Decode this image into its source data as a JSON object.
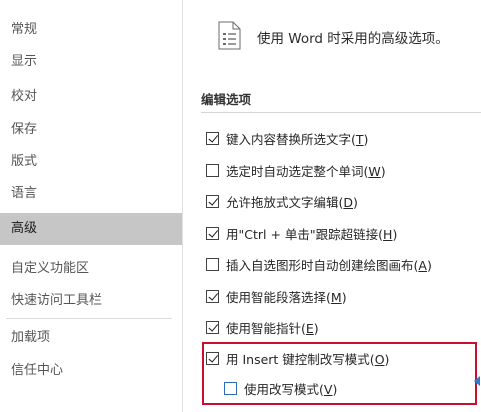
{
  "sidebar": {
    "items": [
      {
        "label": "常规"
      },
      {
        "label": "显示"
      },
      {
        "label": "校对"
      },
      {
        "label": "保存"
      },
      {
        "label": "版式"
      },
      {
        "label": "语言"
      },
      {
        "label": "高级",
        "active": true
      },
      {
        "label": "自定义功能区"
      },
      {
        "label": "快速访问工具栏"
      },
      {
        "label": "加载项"
      },
      {
        "label": "信任中心"
      }
    ]
  },
  "main": {
    "header_text": "使用 Word 时采用的高级选项。",
    "header_icon": "document-settings-icon",
    "section_title": "编辑选项",
    "options": [
      {
        "text": "键入内容替换所选文字(",
        "key": "T",
        "tail": ")",
        "checked": true
      },
      {
        "text": "选定时自动选定整个单词(",
        "key": "W",
        "tail": ")",
        "checked": false
      },
      {
        "text": "允许拖放式文字编辑(",
        "key": "D",
        "tail": ")",
        "checked": true
      },
      {
        "text": "用\"Ctrl + 单击\"跟踪超链接(",
        "key": "H",
        "tail": ")",
        "checked": true
      },
      {
        "text": "插入自选图形时自动创建绘图画布(",
        "key": "A",
        "tail": ")",
        "checked": false
      },
      {
        "text": "使用智能段落选择(",
        "key": "M",
        "tail": ")",
        "checked": true
      },
      {
        "text": "使用智能指针(",
        "key": "E",
        "tail": ")",
        "checked": true
      },
      {
        "text": "用 Insert 键控制改写模式(",
        "key": "O",
        "tail": ")",
        "checked": true
      },
      {
        "text": "使用改写模式(",
        "key": "V",
        "tail": ")",
        "checked": false
      }
    ]
  },
  "colors": {
    "active_nav_bg": "#c6c6c6",
    "highlight_border": "#c8102e",
    "focus_checkbox": "#2a6ebb"
  }
}
